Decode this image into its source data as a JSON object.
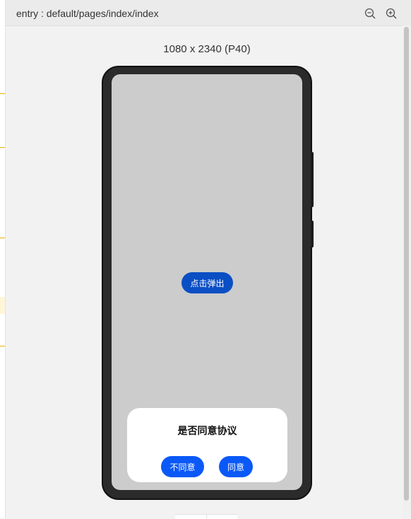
{
  "toolbar": {
    "path": "entry : default/pages/index/index",
    "zoom_out_icon": "zoom-out-icon",
    "zoom_in_icon": "zoom-in-icon"
  },
  "device": {
    "label": "1080 x 2340 (P40)"
  },
  "screen": {
    "popup_button_label": "点击弹出"
  },
  "dialog": {
    "title": "是否同意协议",
    "disagree_label": "不同意",
    "agree_label": "同意"
  },
  "colors": {
    "primary_button": "#0a59f7",
    "trigger_button": "#0a4fc4",
    "screen_background": "#cccccc",
    "guide_mark": "#e8b300"
  }
}
